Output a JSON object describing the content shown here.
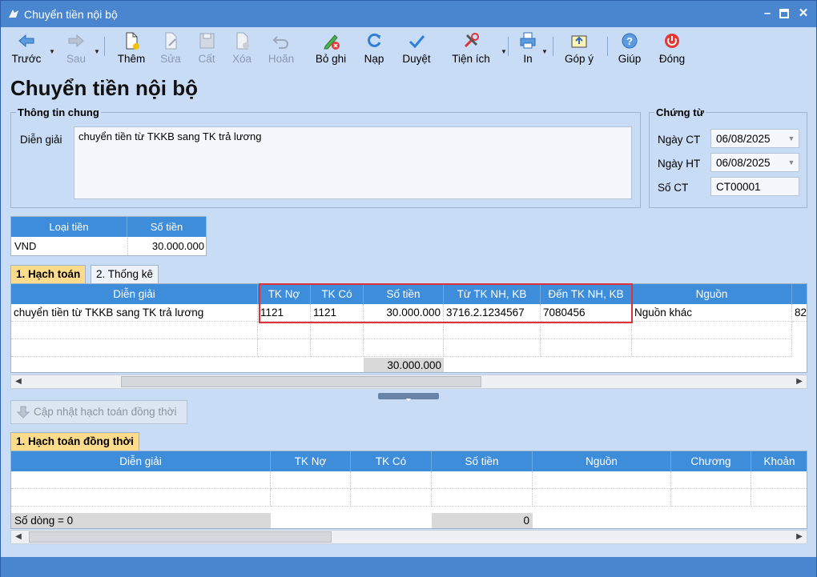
{
  "window": {
    "title": "Chuyển tiền nội bộ"
  },
  "toolbar": {
    "items": [
      {
        "label": "Trước",
        "icon": "arrow-left-icon",
        "enabled": true
      },
      {
        "label": "Sau",
        "icon": "arrow-right-icon",
        "enabled": false
      },
      {
        "label": "Thêm",
        "icon": "new-doc-icon",
        "enabled": true
      },
      {
        "label": "Sửa",
        "icon": "edit-doc-icon",
        "enabled": false
      },
      {
        "label": "Cất",
        "icon": "save-icon",
        "enabled": false
      },
      {
        "label": "Xóa",
        "icon": "delete-doc-icon",
        "enabled": false
      },
      {
        "label": "Hoãn",
        "icon": "undo-icon",
        "enabled": false
      },
      {
        "label": "Bỏ ghi",
        "icon": "unpost-icon",
        "enabled": true
      },
      {
        "label": "Nạp",
        "icon": "refresh-icon",
        "enabled": true
      },
      {
        "label": "Duyệt",
        "icon": "check-icon",
        "enabled": true
      },
      {
        "label": "Tiện ích",
        "icon": "tools-icon",
        "enabled": true
      },
      {
        "label": "In",
        "icon": "printer-icon",
        "enabled": true
      },
      {
        "label": "Góp ý",
        "icon": "feedback-icon",
        "enabled": true
      },
      {
        "label": "Giúp",
        "icon": "help-icon",
        "enabled": true
      },
      {
        "label": "Đóng",
        "icon": "power-icon",
        "enabled": true
      }
    ]
  },
  "page_title": "Chuyển tiền nội bộ",
  "general_info": {
    "legend": "Thông tin chung",
    "description_label": "Diễn giải",
    "description_value": "chuyển tiền từ TKKB sang TK trả lương"
  },
  "voucher": {
    "legend": "Chứng từ",
    "date_ct_label": "Ngày CT",
    "date_ct_value": "06/08/2025",
    "date_ht_label": "Ngày HT",
    "date_ht_value": "06/08/2025",
    "number_label": "Số CT",
    "number_value": "CT00001"
  },
  "currency_grid": {
    "headers": [
      "Loại tiền",
      "Số tiền"
    ],
    "row": [
      "VND",
      "30.000.000"
    ]
  },
  "tabs": [
    {
      "label": "1. Hạch toán",
      "active": true
    },
    {
      "label": "2. Thống kê",
      "active": false
    }
  ],
  "accounting_grid": {
    "headers": [
      "Diễn giải",
      "TK Nợ",
      "TK Có",
      "Số tiền",
      "Từ TK NH, KB",
      "Đến TK NH, KB",
      "Nguồn",
      ""
    ],
    "rows": [
      [
        "chuyển tiền từ TKKB sang TK trả lương",
        "1121",
        "1121",
        "30.000.000",
        "3716.2.1234567",
        "7080456",
        "Nguồn khác",
        "82"
      ]
    ],
    "total": "30.000.000"
  },
  "update_button": "Cập nhật hạch toán đồng thời",
  "concurrent_tab": "1. Hạch toán đồng thời",
  "concurrent_grid": {
    "headers": [
      "Diễn giải",
      "TK Nợ",
      "TK Có",
      "Số tiền",
      "Nguồn",
      "Chương",
      "Khoản"
    ],
    "row_count_label": "Số dòng = 0",
    "total": "0"
  },
  "colors": {
    "accent": "#4a86cf",
    "header": "#3e8ddb",
    "active_tab": "#fcdc8b",
    "highlight": "#e0313a"
  }
}
